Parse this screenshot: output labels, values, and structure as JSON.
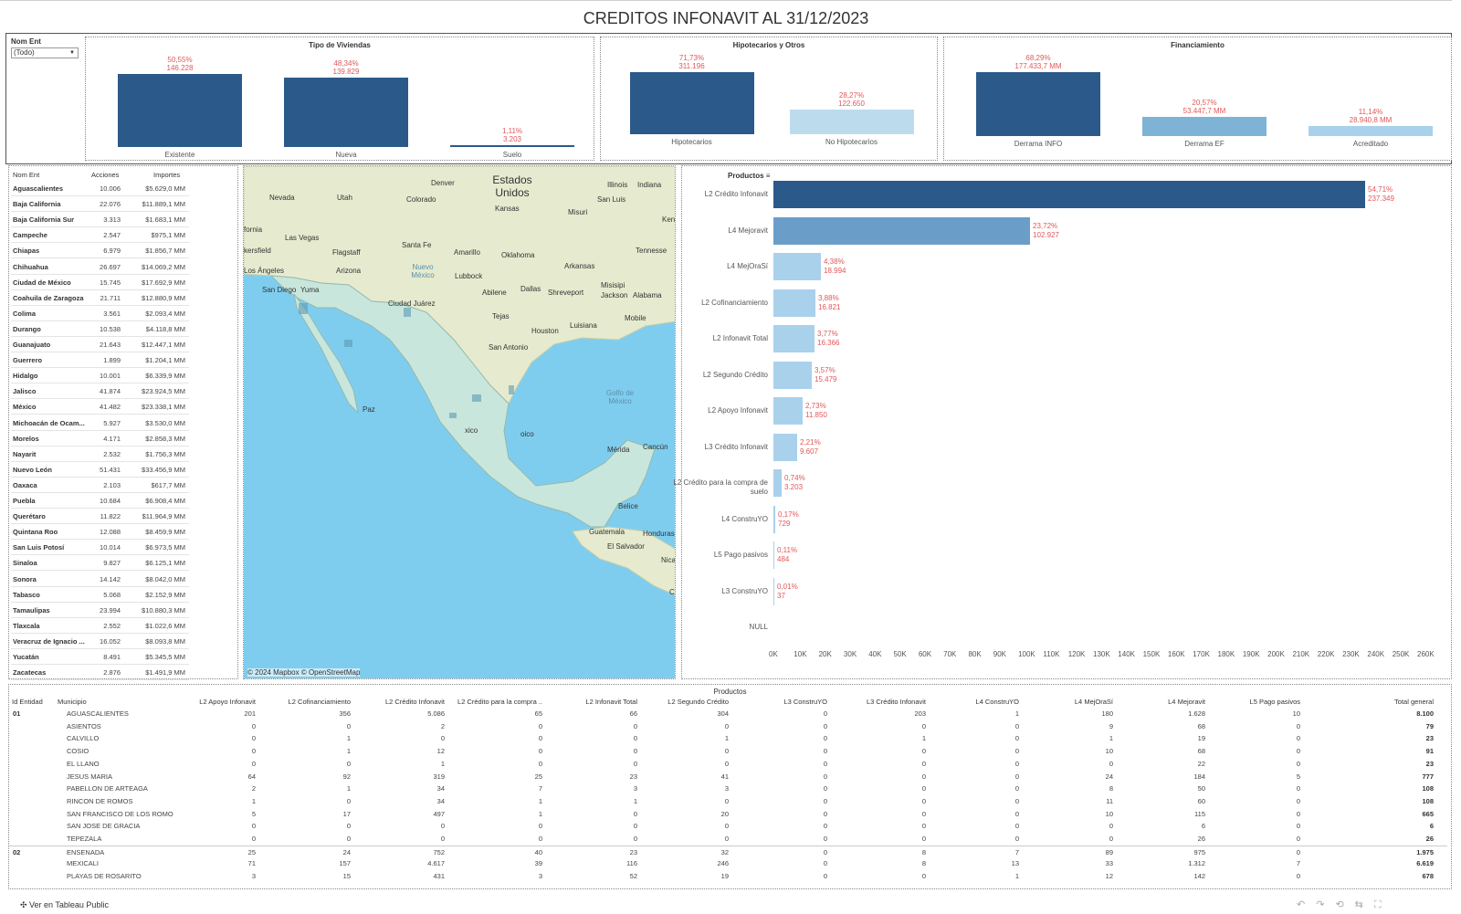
{
  "title": "CREDITOS INFONAVIT AL 31/12/2023",
  "filter": {
    "label": "Nom Ent",
    "value": "(Todo)"
  },
  "tipo_viviendas": {
    "title": "Tipo de Viviendas",
    "bars": [
      {
        "category": "Existente",
        "pct": "50,55%",
        "value": "146.228",
        "num": 146228
      },
      {
        "category": "Nueva",
        "pct": "48,34%",
        "value": "139.829",
        "num": 139829
      },
      {
        "category": "Suelo",
        "pct": "1,11%",
        "value": "3.203",
        "num": 3203
      }
    ],
    "color": "#2b5a8a"
  },
  "hipotecarios": {
    "title": "Hipotecarios y Otros",
    "bars": [
      {
        "category": "Hipotecarios",
        "pct": "71,73%",
        "value": "311.196",
        "num": 311196,
        "color": "#2b5a8a"
      },
      {
        "category": "No Hipotecarios",
        "pct": "28,27%",
        "value": "122.650",
        "num": 122650,
        "color": "#bcdcee"
      }
    ]
  },
  "financiamiento": {
    "title": "Financiamiento",
    "bars": [
      {
        "category": "Derrama INFO",
        "pct": "68,29%",
        "value": "177.433,7 MM",
        "num": 177433.7,
        "color": "#2b5a8a"
      },
      {
        "category": "Derrama EF",
        "pct": "20,57%",
        "value": "53.447,7 MM",
        "num": 53447.7,
        "color": "#7fb3d5"
      },
      {
        "category": "Acreditado",
        "pct": "11,14%",
        "value": "28.940,8 MM",
        "num": 28940.8,
        "color": "#a9d1ec"
      }
    ]
  },
  "state_table": {
    "headers": [
      "Nom Ent",
      "Acciones",
      "Importes"
    ],
    "rows": [
      [
        "Aguascalientes",
        "10.006",
        "$5.629,0 MM"
      ],
      [
        "Baja California",
        "22.076",
        "$11.889,1 MM"
      ],
      [
        "Baja California Sur",
        "3.313",
        "$1.683,1 MM"
      ],
      [
        "Campeche",
        "2.547",
        "$975,1 MM"
      ],
      [
        "Chiapas",
        "6.979",
        "$1.856,7 MM"
      ],
      [
        "Chihuahua",
        "26.697",
        "$14.069,2 MM"
      ],
      [
        "Ciudad de México",
        "15.745",
        "$17.692,9 MM"
      ],
      [
        "Coahuila de Zaragoza",
        "21.711",
        "$12.880,9 MM"
      ],
      [
        "Colima",
        "3.561",
        "$2.093,4 MM"
      ],
      [
        "Durango",
        "10.538",
        "$4.118,8 MM"
      ],
      [
        "Guanajuato",
        "21.643",
        "$12.447,1 MM"
      ],
      [
        "Guerrero",
        "1.899",
        "$1.204,1 MM"
      ],
      [
        "Hidalgo",
        "10.001",
        "$6.339,9 MM"
      ],
      [
        "Jalisco",
        "41.874",
        "$23.924,5 MM"
      ],
      [
        "México",
        "41.482",
        "$23.338,1 MM"
      ],
      [
        "Michoacán de Ocam...",
        "5.927",
        "$3.530,0 MM"
      ],
      [
        "Morelos",
        "4.171",
        "$2.858,3 MM"
      ],
      [
        "Nayarit",
        "2.532",
        "$1.756,3 MM"
      ],
      [
        "Nuevo León",
        "51.431",
        "$33.456,9 MM"
      ],
      [
        "Oaxaca",
        "2.103",
        "$617,7 MM"
      ],
      [
        "Puebla",
        "10.684",
        "$6.908,4 MM"
      ],
      [
        "Querétaro",
        "11.822",
        "$11.964,9 MM"
      ],
      [
        "Quintana Roo",
        "12.088",
        "$8.459,9 MM"
      ],
      [
        "San Luis Potosí",
        "10.014",
        "$6.973,5 MM"
      ],
      [
        "Sinaloa",
        "9.827",
        "$6.125,1 MM"
      ],
      [
        "Sonora",
        "14.142",
        "$8.042,0 MM"
      ],
      [
        "Tabasco",
        "5.068",
        "$2.152,9 MM"
      ],
      [
        "Tamaulipas",
        "23.994",
        "$10.880,3 MM"
      ],
      [
        "Tlaxcala",
        "2.552",
        "$1.022,6 MM"
      ],
      [
        "Veracruz de Ignacio ...",
        "16.052",
        "$8.093,8 MM"
      ],
      [
        "Yucatán",
        "8.491",
        "$5.345,5 MM"
      ],
      [
        "Zacatecas",
        "2.876",
        "$1.491,9 MM"
      ]
    ]
  },
  "map": {
    "labels": [
      "Estados Unidos",
      "Denver",
      "Nevada",
      "Utah",
      "Colorado",
      "Kansas",
      "Illinois",
      "Indiana",
      "San Luis",
      "Misuri",
      "Ken",
      "fornia",
      "Las Vegas",
      "Santa Fe",
      "Amarillo",
      "Oklahoma",
      "Tennesse",
      "kersfield",
      "Flagstaff",
      "Arizona",
      "Nuevo México",
      "Lubbock",
      "Arkansas",
      "Los Ángeles",
      "Misisipi",
      "San Diego",
      "Yuma",
      "Abilene",
      "Dallas",
      "Shreveport",
      "Jackson",
      "Alabama",
      "Ciudad Juárez",
      "Tejas",
      "Mobile",
      "Luisiana",
      "Houston",
      "San Antonio",
      "Golfo de México",
      "Paz",
      "Mérida",
      "Cancún",
      "oico",
      "xico",
      "Belice",
      "Guatemala",
      "Honduras",
      "El Salvador",
      "Nicar",
      "C"
    ],
    "attribution": "© 2024 Mapbox  © OpenStreetMap"
  },
  "productos": {
    "title": "Productos",
    "items": [
      {
        "label": "L2 Crédito Infonavit",
        "pct": "54,71%",
        "value": "237.349",
        "num": 237349,
        "color": "#2b5a8a"
      },
      {
        "label": "L4 Mejoravit",
        "pct": "23,72%",
        "value": "102.927",
        "num": 102927,
        "color": "#6a9ec9"
      },
      {
        "label": "L4 MejOraSí",
        "pct": "4,38%",
        "value": "18.994",
        "num": 18994,
        "color": "#a9d1ec"
      },
      {
        "label": "L2 Cofinanciamiento",
        "pct": "3,88%",
        "value": "16.821",
        "num": 16821,
        "color": "#a9d1ec"
      },
      {
        "label": "L2 Infonavit Total",
        "pct": "3,77%",
        "value": "16.366",
        "num": 16366,
        "color": "#a9d1ec"
      },
      {
        "label": "L2 Segundo Crédito",
        "pct": "3,57%",
        "value": "15.479",
        "num": 15479,
        "color": "#a9d1ec"
      },
      {
        "label": "L2 Apoyo Infonavit",
        "pct": "2,73%",
        "value": "11.850",
        "num": 11850,
        "color": "#a9d1ec"
      },
      {
        "label": "L3 Crédito Infonavit",
        "pct": "2,21%",
        "value": "9.607",
        "num": 9607,
        "color": "#a9d1ec"
      },
      {
        "label": "L2 Crédito para la compra de suelo",
        "pct": "0,74%",
        "value": "3.203",
        "num": 3203,
        "color": "#a9d1ec"
      },
      {
        "label": "L4 ConstruYO",
        "pct": "0,17%",
        "value": "729",
        "num": 729,
        "color": "#a9d1ec"
      },
      {
        "label": "L5 Pago pasivos",
        "pct": "0,11%",
        "value": "484",
        "num": 484,
        "color": "#a9d1ec"
      },
      {
        "label": "L3 ConstruYO",
        "pct": "0,01%",
        "value": "37",
        "num": 37,
        "color": "#a9d1ec"
      },
      {
        "label": "NULL",
        "pct": "",
        "value": "",
        "num": 0,
        "color": "#a9d1ec"
      }
    ],
    "axis_ticks": [
      "0K",
      "10K",
      "20K",
      "30K",
      "40K",
      "50K",
      "60K",
      "70K",
      "80K",
      "90K",
      "100K",
      "110K",
      "120K",
      "130K",
      "140K",
      "150K",
      "160K",
      "170K",
      "180K",
      "190K",
      "200K",
      "210K",
      "220K",
      "230K",
      "240K",
      "250K",
      "260K"
    ]
  },
  "bottom_table": {
    "title": "Productos",
    "headers": [
      "Id Entidad",
      "Municipio",
      "L2 Apoyo Infonavit",
      "L2 Cofinanciamiento",
      "L2 Crédito Infonavit",
      "L2 Crédito para la compra ..",
      "L2 Infonavit Total",
      "L2 Segundo Crédito",
      "L3 ConstruYO",
      "L3 Crédito Infonavit",
      "L4 ConstruYO",
      "L4 MejOraSí",
      "L4 Mejoravit",
      "L5 Pago pasivos",
      "Total general"
    ],
    "rows": [
      [
        "01",
        "AGUASCALIENTES",
        "201",
        "356",
        "5.086",
        "65",
        "66",
        "304",
        "0",
        "203",
        "1",
        "180",
        "1.628",
        "10",
        "8.100"
      ],
      [
        "",
        "ASIENTOS",
        "0",
        "0",
        "2",
        "0",
        "0",
        "0",
        "0",
        "0",
        "0",
        "9",
        "68",
        "0",
        "79"
      ],
      [
        "",
        "CALVILLO",
        "0",
        "1",
        "0",
        "0",
        "0",
        "1",
        "0",
        "1",
        "0",
        "1",
        "19",
        "0",
        "23"
      ],
      [
        "",
        "COSIO",
        "0",
        "1",
        "12",
        "0",
        "0",
        "0",
        "0",
        "0",
        "0",
        "10",
        "68",
        "0",
        "91"
      ],
      [
        "",
        "EL LLANO",
        "0",
        "0",
        "1",
        "0",
        "0",
        "0",
        "0",
        "0",
        "0",
        "0",
        "22",
        "0",
        "23"
      ],
      [
        "",
        "JESUS MARIA",
        "64",
        "92",
        "319",
        "25",
        "23",
        "41",
        "0",
        "0",
        "0",
        "24",
        "184",
        "5",
        "777"
      ],
      [
        "",
        "PABELLON DE ARTEAGA",
        "2",
        "1",
        "34",
        "7",
        "3",
        "3",
        "0",
        "0",
        "0",
        "8",
        "50",
        "0",
        "108"
      ],
      [
        "",
        "RINCON DE ROMOS",
        "1",
        "0",
        "34",
        "1",
        "1",
        "0",
        "0",
        "0",
        "0",
        "11",
        "60",
        "0",
        "108"
      ],
      [
        "",
        "SAN FRANCISCO DE LOS ROMO",
        "5",
        "17",
        "497",
        "1",
        "0",
        "20",
        "0",
        "0",
        "0",
        "10",
        "115",
        "0",
        "665"
      ],
      [
        "",
        "SAN JOSE DE GRACIA",
        "0",
        "0",
        "0",
        "0",
        "0",
        "0",
        "0",
        "0",
        "0",
        "0",
        "6",
        "0",
        "6"
      ],
      [
        "",
        "TEPEZALA",
        "0",
        "0",
        "0",
        "0",
        "0",
        "0",
        "0",
        "0",
        "0",
        "0",
        "26",
        "0",
        "26"
      ],
      [
        "02",
        "ENSENADA",
        "25",
        "24",
        "752",
        "40",
        "23",
        "32",
        "0",
        "8",
        "7",
        "89",
        "975",
        "0",
        "1.975"
      ],
      [
        "",
        "MEXICALI",
        "71",
        "157",
        "4.617",
        "39",
        "116",
        "246",
        "0",
        "8",
        "13",
        "33",
        "1.312",
        "7",
        "6.619"
      ],
      [
        "",
        "PLAYAS DE ROSARITO",
        "3",
        "15",
        "431",
        "3",
        "52",
        "19",
        "0",
        "0",
        "1",
        "12",
        "142",
        "0",
        "678"
      ]
    ]
  },
  "footer": {
    "label": "Ver en Tableau Public"
  }
}
